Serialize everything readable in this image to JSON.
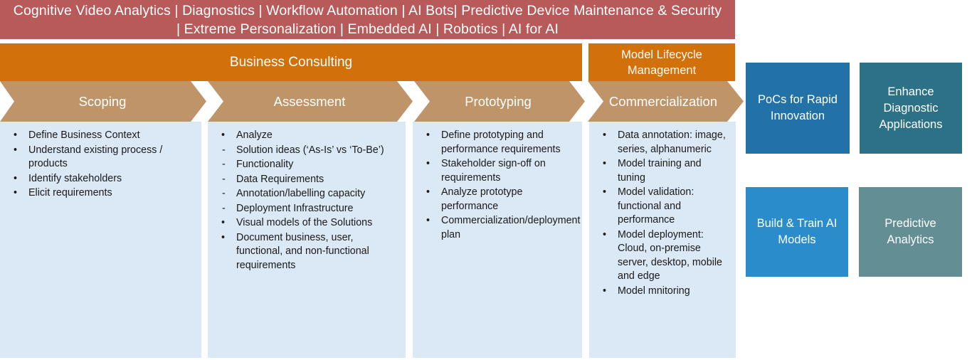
{
  "banner": {
    "line1": "Cognitive Video Analytics | Diagnostics | Workflow Automation | AI Bots| Predictive Device Maintenance & Security",
    "line2": "| Extreme Personalization | Embedded AI | Robotics | AI for AI",
    "color": "#b85a5a"
  },
  "group_headers": [
    {
      "label": "Business Consulting",
      "color": "#d2700a"
    },
    {
      "label": "Model Lifecycle Management",
      "color": "#d2700a"
    }
  ],
  "phases": [
    {
      "label": "Scoping"
    },
    {
      "label": "Assessment"
    },
    {
      "label": "Prototyping"
    },
    {
      "label": "Commercialization"
    }
  ],
  "phase_band_color": "#bf9469",
  "panel_color": "#dbe8f5",
  "panels": [
    {
      "items": [
        {
          "marker": "•",
          "text": "Define Business Context"
        },
        {
          "marker": "•",
          "text": "Understand existing process / products"
        },
        {
          "marker": "•",
          "text": "Identify stakeholders"
        },
        {
          "marker": "•",
          "text": "Elicit requirements"
        }
      ]
    },
    {
      "items": [
        {
          "marker": "•",
          "text": "Analyze"
        },
        {
          "marker": "-",
          "text": "Solution ideas (‘As-Is’ vs ‘To-Be’)"
        },
        {
          "marker": "-",
          "text": "Functionality"
        },
        {
          "marker": "-",
          "text": "Data Requirements"
        },
        {
          "marker": "-",
          "text": "Annotation/labelling capacity"
        },
        {
          "marker": "-",
          "text": "Deployment Infrastructure"
        },
        {
          "marker": "•",
          "text": "Visual models of the Solutions"
        },
        {
          "marker": "•",
          "text": "Document business, user, functional, and non-functional requirements"
        }
      ]
    },
    {
      "items": [
        {
          "marker": "•",
          "text": "Define prototyping and performance requirements"
        },
        {
          "marker": "•",
          "text": "Stakeholder sign-off on requirements"
        },
        {
          "marker": "•",
          "text": "Analyze prototype performance"
        },
        {
          "marker": "•",
          "text": "Commercialization/deployment plan"
        }
      ]
    },
    {
      "items": [
        {
          "marker": "•",
          "text": "Data annotation: image, series, alphanumeric"
        },
        {
          "marker": "•",
          "text": "Model training and tuning"
        },
        {
          "marker": "•",
          "text": "Model validation: functional and performance"
        },
        {
          "marker": "•",
          "text": "Model deployment: Cloud, on-premise server, desktop, mobile and edge"
        },
        {
          "marker": "•",
          "text": "Model mnitoring"
        }
      ]
    }
  ],
  "outcomes": [
    {
      "label": "PoCs for Rapid Innovation",
      "color": "#2272a8"
    },
    {
      "label": "Enhance Diagnostic Applications",
      "color": "#2d7186"
    },
    {
      "label": "Build & Train AI Models",
      "color": "#2a8cca"
    },
    {
      "label": "Predictive Analytics",
      "color": "#638e94"
    }
  ]
}
